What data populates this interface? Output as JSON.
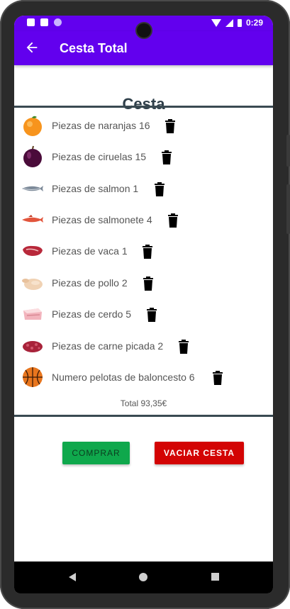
{
  "status": {
    "time": "0:29"
  },
  "appbar": {
    "title": "Cesta Total",
    "back_icon": "arrow-left-icon"
  },
  "basket": {
    "heading": "Cesta",
    "items": [
      {
        "label": "Piezas de naranjas 16",
        "icon": "orange-icon"
      },
      {
        "label": "Piezas de ciruelas 15",
        "icon": "plum-icon"
      },
      {
        "label": "Piezas de salmon 1",
        "icon": "salmon-icon"
      },
      {
        "label": "Piezas de salmonete 4",
        "icon": "red-mullet-icon"
      },
      {
        "label": "Piezas de vaca 1",
        "icon": "beef-icon"
      },
      {
        "label": "Piezas de pollo 2",
        "icon": "chicken-icon"
      },
      {
        "label": "Piezas de cerdo 5",
        "icon": "pork-icon"
      },
      {
        "label": "Piezas de carne picada 2",
        "icon": "minced-meat-icon"
      },
      {
        "label": "Numero pelotas de baloncesto 6",
        "icon": "basketball-icon"
      }
    ],
    "total": "Total 93,35€"
  },
  "actions": {
    "buy_label": "COMPRAR",
    "empty_label": "VACIAR CESTA"
  },
  "colors": {
    "primary": "#6200ee",
    "buy": "#0fa84c",
    "empty": "#d30404",
    "divider": "#3a4a52"
  }
}
